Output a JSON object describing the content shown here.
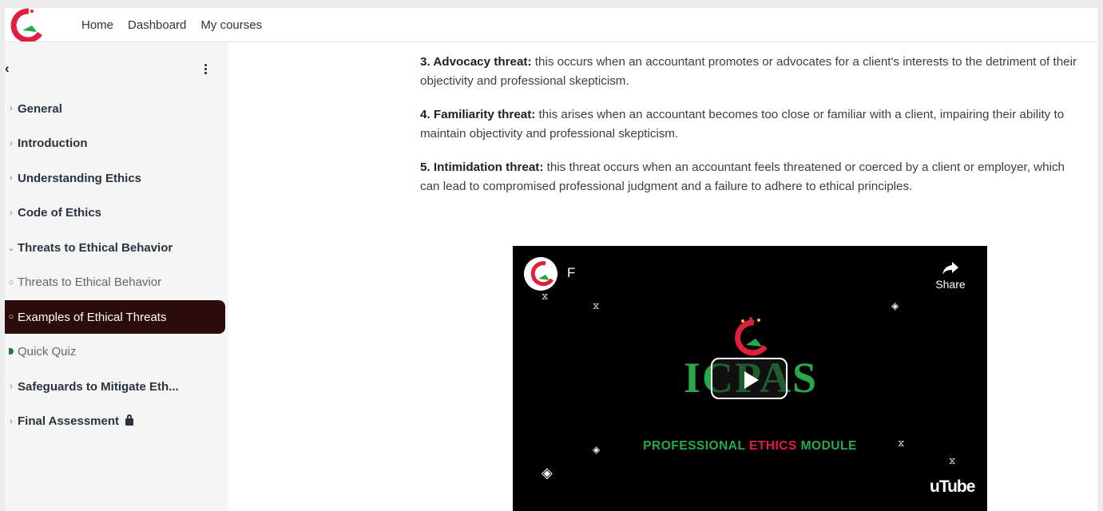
{
  "nav": {
    "links": [
      "Home",
      "Dashboard",
      "My courses"
    ]
  },
  "drawer": {
    "items": [
      {
        "type": "section",
        "marker": "›",
        "label": "General"
      },
      {
        "type": "section",
        "marker": "›",
        "label": "Introduction"
      },
      {
        "type": "section",
        "marker": "›",
        "label": "Understanding Ethics"
      },
      {
        "type": "section",
        "marker": "›",
        "label": "Code of Ethics"
      },
      {
        "type": "section",
        "marker": "⌄",
        "label": "Threats to Ethical Behavior"
      },
      {
        "type": "activity",
        "marker": "○",
        "label": "Threats to Ethical Behavior"
      },
      {
        "type": "activity",
        "marker": "○",
        "label": "Examples of Ethical Threats",
        "active": true
      },
      {
        "type": "activity",
        "marker": "complete",
        "label": "Quick Quiz"
      },
      {
        "type": "section",
        "marker": "›",
        "label": "Safeguards to Mitigate Eth..."
      },
      {
        "type": "section",
        "marker": "›",
        "label": "Final Assessment",
        "locked": true
      }
    ]
  },
  "content": {
    "paragraphs": [
      {
        "bold": "3. Advocacy threat:",
        "text": " this occurs when an accountant promotes or advocates for a client's interests to the detriment of their objectivity and professional skepticism."
      },
      {
        "bold": "4. Familiarity threat:",
        "text": " this arises when an accountant becomes too close or familiar with a client, impairing their ability to maintain objectivity and professional skepticism."
      },
      {
        "bold": "5. Intimidation threat:",
        "text": " this threat occurs when an accountant feels threatened or coerced by a client or employer, which can lead to compromised professional judgment and a failure to adhere to ethical principles."
      }
    ]
  },
  "video": {
    "title_visible": "F",
    "share_label": "Share",
    "brand": "ICPAS",
    "module_parts": [
      "PROFESSIONAL ",
      "ETHICS",
      " MODULE"
    ],
    "youtube_text": "uTube"
  },
  "colors": {
    "brand_red": "#e01f3d",
    "brand_green": "#27a84a",
    "active_bg": "#2b0b0b"
  }
}
